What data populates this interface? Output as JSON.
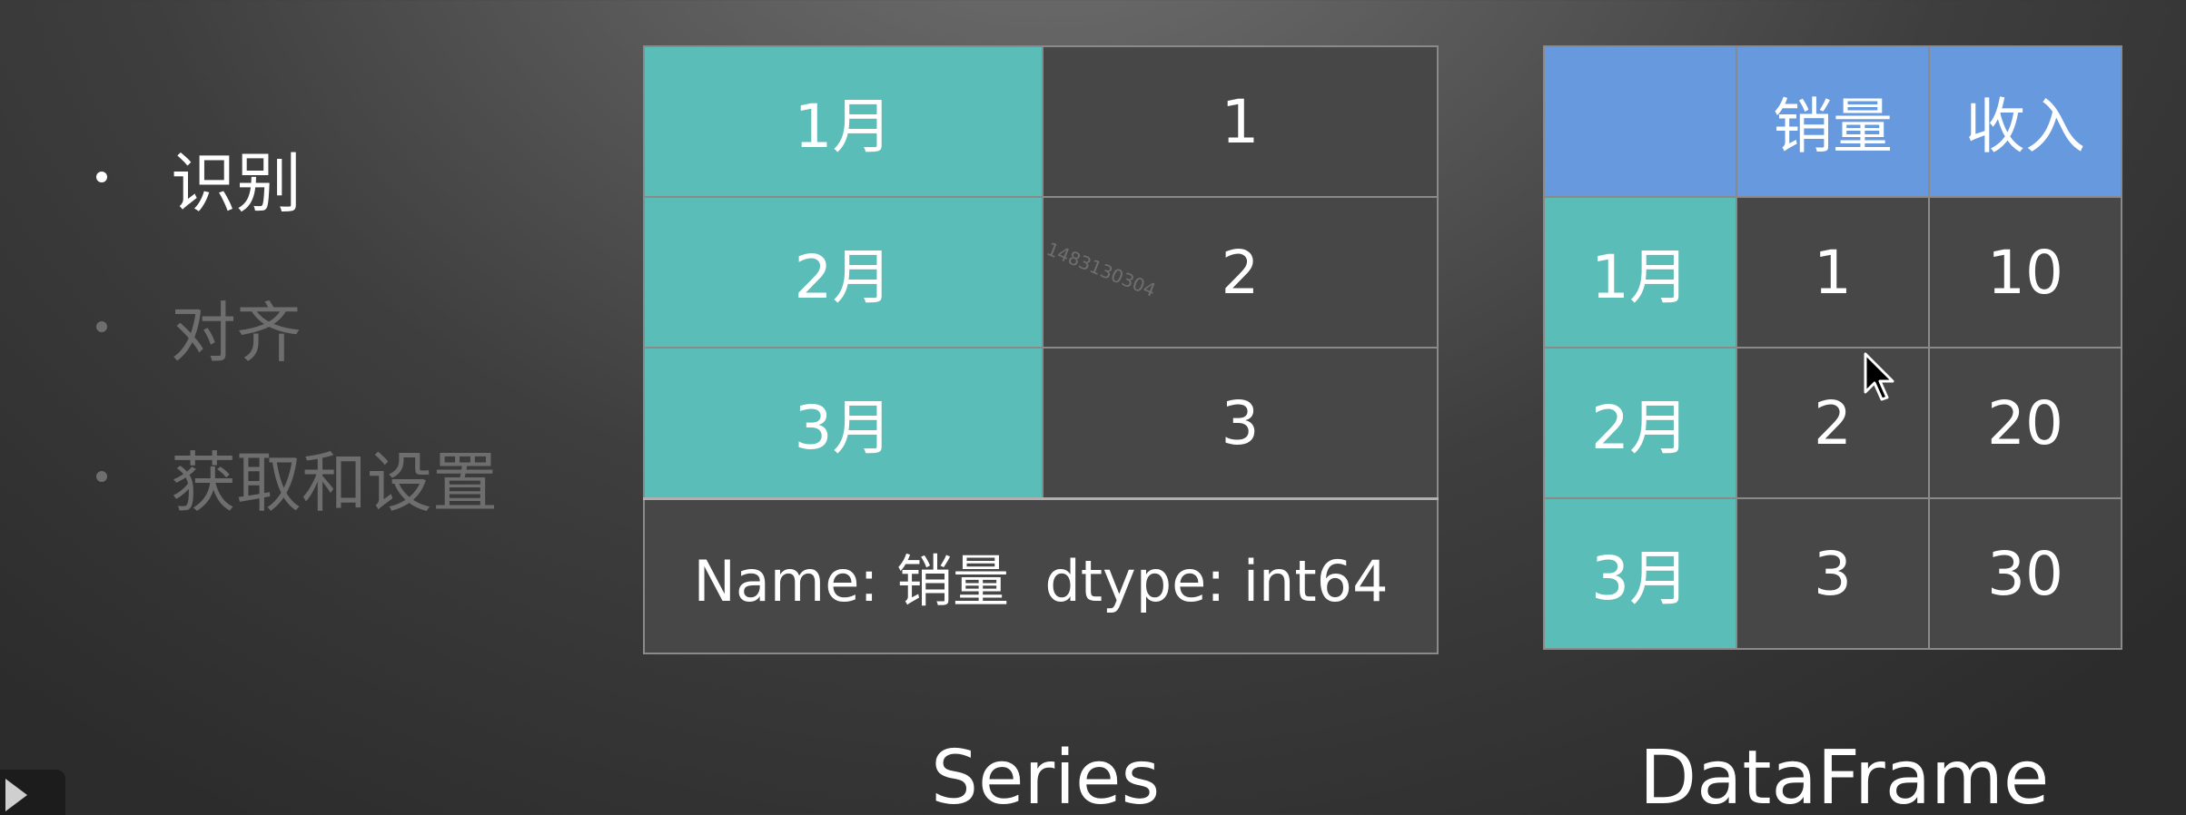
{
  "outline": {
    "items": [
      {
        "label": "识别",
        "state": "active"
      },
      {
        "label": "对齐",
        "state": "inactive"
      },
      {
        "label": "获取和设置",
        "state": "inactive"
      }
    ]
  },
  "series": {
    "rows": [
      {
        "index": "1月",
        "value": "1"
      },
      {
        "index": "2月",
        "value": "2"
      },
      {
        "index": "3月",
        "value": "3"
      }
    ],
    "footer": "Name: 销量  dtype: int64",
    "caption": "Series"
  },
  "dataframe": {
    "columns": [
      "",
      "销量",
      "收入"
    ],
    "rows": [
      {
        "index": "1月",
        "sales": "1",
        "revenue": "10"
      },
      {
        "index": "2月",
        "sales": "2",
        "revenue": "20"
      },
      {
        "index": "3月",
        "sales": "3",
        "revenue": "30"
      }
    ],
    "caption": "DataFrame"
  },
  "watermark": "1483130304",
  "colors": {
    "teal": "#5bbdb7",
    "blue": "#6699dd",
    "cell_dark": "#474747",
    "inactive_text": "#6e6e6e"
  },
  "icons": {
    "play": "play-icon",
    "cursor": "mouse-pointer-icon"
  }
}
